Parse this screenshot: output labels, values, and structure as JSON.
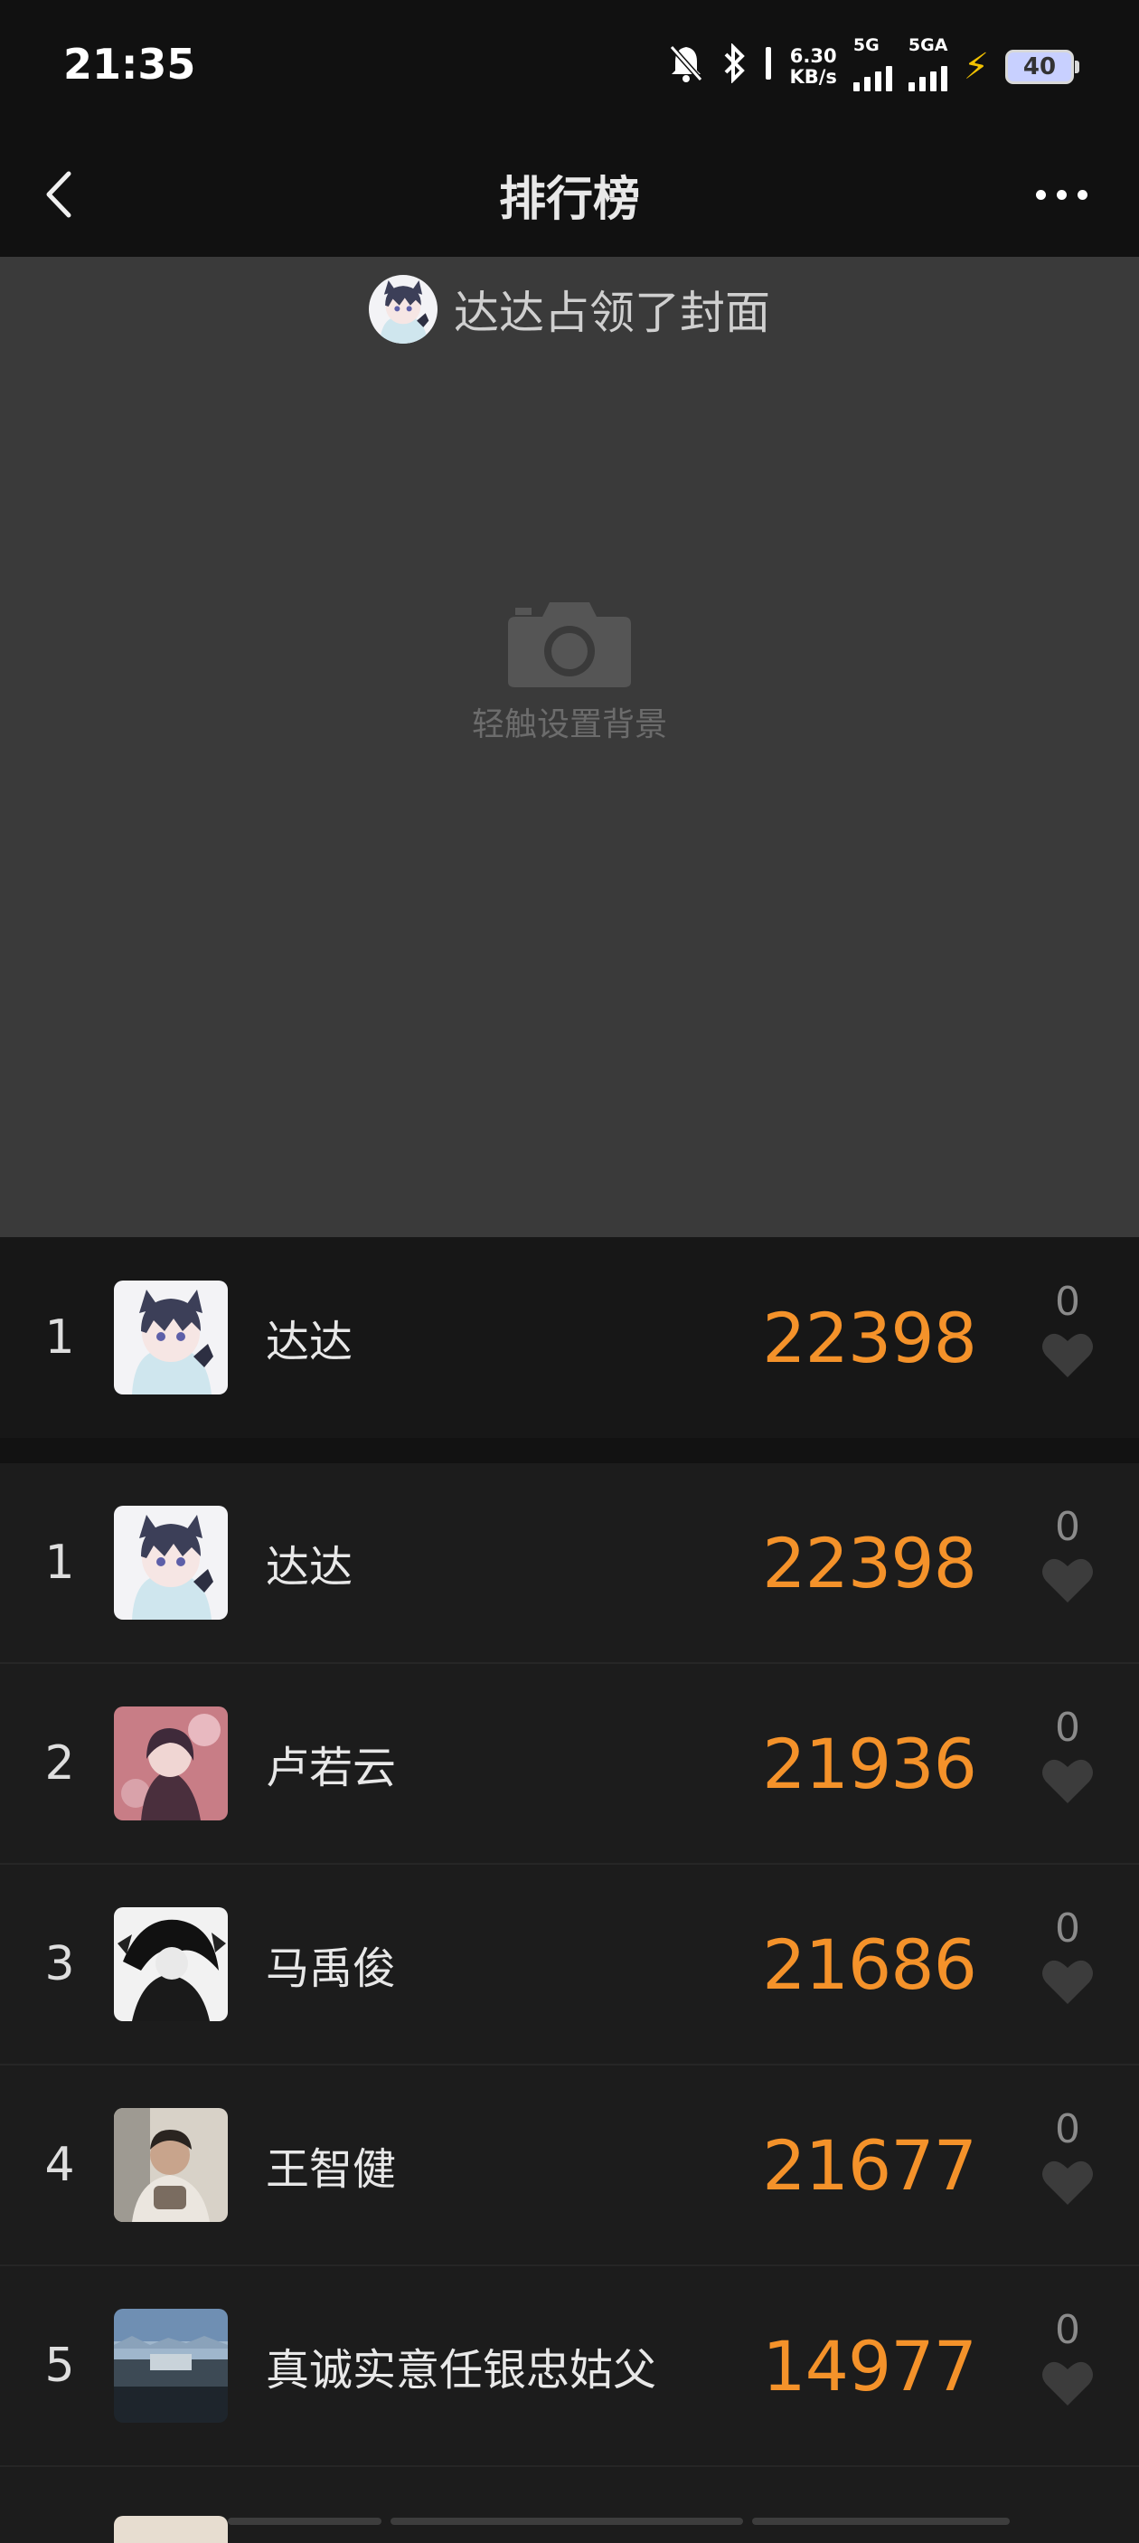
{
  "status_bar": {
    "time": "21:35",
    "net_speed_value": "6.30",
    "net_speed_unit": "KB/s",
    "sim1_label": "5G",
    "sim2_label": "5GA",
    "battery": "40"
  },
  "nav": {
    "title": "排行榜"
  },
  "cover": {
    "owner_text": "达达占领了封面",
    "set_background_label": "轻触设置背景"
  },
  "my_entry": {
    "rank": "1",
    "name": "达达",
    "steps": "22398",
    "likes": "0"
  },
  "ranking": [
    {
      "rank": "1",
      "name": "达达",
      "steps": "22398",
      "likes": "0"
    },
    {
      "rank": "2",
      "name": "卢若云",
      "steps": "21936",
      "likes": "0"
    },
    {
      "rank": "3",
      "name": "马禹俊",
      "steps": "21686",
      "likes": "0"
    },
    {
      "rank": "4",
      "name": "王智健",
      "steps": "21677",
      "likes": "0"
    },
    {
      "rank": "5",
      "name": "真诚实意任银忠姑父",
      "steps": "14977",
      "likes": "0"
    }
  ],
  "colors": {
    "steps": "#f4922a",
    "background": "#1c1c1c",
    "cover": "#3a3a3a"
  }
}
